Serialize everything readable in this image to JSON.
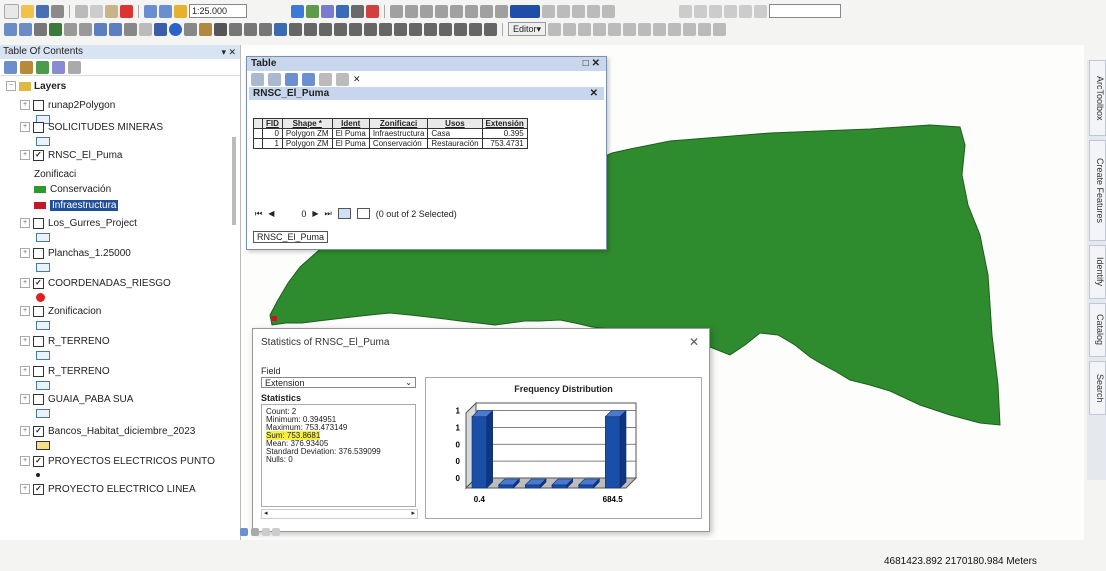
{
  "toolbar": {
    "scale_value": "1:25.000",
    "editor_label": "Editor▾"
  },
  "toc": {
    "title": "Table Of Contents",
    "layers_label": "Layers",
    "items": [
      {
        "label": "runap2Polygon",
        "checked": false,
        "symbol": "rect",
        "has_check": true
      },
      {
        "label": "SOLICITUDES MINERAS",
        "checked": false,
        "symbol": "rect",
        "has_check": true
      },
      {
        "label": "RNSC_El_Puma",
        "checked": true,
        "symbol": "none",
        "has_check": true
      },
      {
        "label": "Zonificaci",
        "sublabel": true,
        "symbol": "none"
      },
      {
        "label": "Conservación",
        "sublabel": true,
        "symbol": "fill",
        "color": "#2e9a2e"
      },
      {
        "label": "Infraestructura",
        "sublabel": true,
        "symbol": "fill",
        "color": "#c0182c",
        "highlight": true
      },
      {
        "label": "Los_Gurres_Project",
        "checked": false,
        "symbol": "rect",
        "has_check": true
      },
      {
        "label": "Planchas_1.25000",
        "checked": false,
        "symbol": "rect",
        "has_check": true
      },
      {
        "label": "COORDENADAS_RIESGO",
        "checked": true,
        "symbol": "dot",
        "has_check": true
      },
      {
        "label": "Zonificacion",
        "checked": false,
        "symbol": "rect",
        "has_check": true
      },
      {
        "label": "R_TERRENO",
        "checked": false,
        "symbol": "rect",
        "has_check": true
      },
      {
        "label": "R_TERRENO",
        "checked": false,
        "symbol": "rect",
        "has_check": true
      },
      {
        "label": "GUAIA_PABA SUA",
        "checked": false,
        "symbol": "rect",
        "has_check": true
      },
      {
        "label": "Bancos_Habitat_diciembre_2023",
        "checked": true,
        "symbol": "yellowrect",
        "has_check": true
      },
      {
        "label": "PROYECTOS ELECTRICOS PUNTO",
        "checked": true,
        "symbol": "smalldot",
        "has_check": true
      },
      {
        "label": "PROYECTO ELECTRICO LINEA",
        "checked": true,
        "symbol": "none",
        "has_check": true
      }
    ]
  },
  "table_window": {
    "title": "Table",
    "subtitle": "RNSC_El_Puma",
    "columns": [
      "FID",
      "Shape *",
      "Ident",
      "Zonificaci",
      "Usos",
      "Extensión"
    ],
    "rows": [
      [
        "0",
        "Polygon ZM",
        "El Puma",
        "Infraestructura",
        "Casa",
        "0.395"
      ],
      [
        "1",
        "Polygon ZM",
        "El Puma",
        "Conservación",
        "Restauración",
        "753.4731"
      ]
    ],
    "record": "0",
    "selection": "(0 out of 2 Selected)",
    "tab": "RNSC_El_Puma"
  },
  "stats_window": {
    "title": "Statistics of RNSC_El_Puma",
    "field_label": "Field",
    "field_value": "Extension",
    "stats_label": "Statistics",
    "stats": [
      {
        "text": "Count:    2"
      },
      {
        "text": "Minimum: 0.394951"
      },
      {
        "text": "Maximum: 753.473149"
      },
      {
        "text": "Sum:      753.8681",
        "highlight": true
      },
      {
        "text": "Mean:     376.93405"
      },
      {
        "text": "Standard Deviation: 376.539099"
      },
      {
        "text": "Nulls:    0"
      }
    ]
  },
  "chart_data": {
    "type": "bar",
    "title": "Frequency Distribution",
    "categories": [
      "0.4",
      "",
      "",
      "",
      "",
      "684.5"
    ],
    "values": [
      1,
      0,
      0,
      0,
      0,
      1
    ],
    "x_tick_labels": [
      "0.4",
      "684.5"
    ],
    "y_ticks": [
      "0",
      "0",
      "0",
      "1",
      "1"
    ],
    "ylim": [
      0,
      1
    ],
    "bar_color": "#1a4fa8"
  },
  "map": {
    "polygon_color": "#2e8b2e",
    "coordinates": "4681423.892  2170180.984 Meters"
  },
  "sidebar": {
    "tabs": [
      "ArcToolbox",
      "Create Features",
      "Identify",
      "Catalog",
      "Search"
    ]
  }
}
